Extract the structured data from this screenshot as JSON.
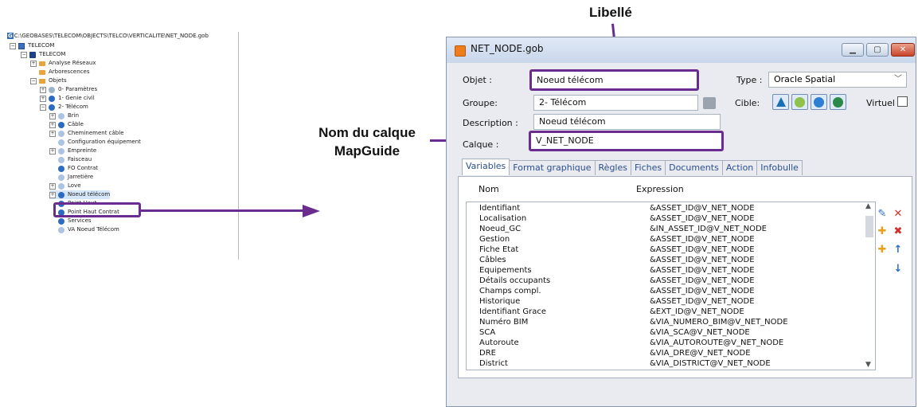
{
  "tree": {
    "path": "C:\\GEOBASES\\TELECOM\\OBJECTS\\TELCO\\VERTICALITE\\NET_NODE.gob",
    "path_badge": "G",
    "items": [
      {
        "label": "TELECOM",
        "icon": "grid-icon"
      },
      {
        "label": "TELECOM",
        "icon": "folder-icon"
      },
      {
        "label": "Analyse Réseaux",
        "icon": "folder-icon"
      },
      {
        "label": "Arborescences",
        "icon": "folder-icon"
      },
      {
        "label": "Objets",
        "icon": "folder-icon"
      },
      {
        "label": "0- Paramètres",
        "icon": "circle-icon"
      },
      {
        "label": "1- Genie civil",
        "icon": "circle-icon"
      },
      {
        "label": "2- Télécom",
        "icon": "circle-icon"
      },
      {
        "label": "Brin",
        "icon": "circle-icon"
      },
      {
        "label": "Câble",
        "icon": "circle-icon"
      },
      {
        "label": "Cheminement câble",
        "icon": "circle-icon"
      },
      {
        "label": "Configuration équipement",
        "icon": "circle-icon"
      },
      {
        "label": "Empreinte",
        "icon": "circle-icon"
      },
      {
        "label": "Faisceau",
        "icon": "circle-icon"
      },
      {
        "label": "FO Contrat",
        "icon": "circle-icon"
      },
      {
        "label": "Jarretière",
        "icon": "circle-icon"
      },
      {
        "label": "Love",
        "icon": "circle-icon"
      },
      {
        "label": "Noeud télécom",
        "icon": "circle-icon"
      },
      {
        "label": "Point Haut",
        "icon": "circle-icon"
      },
      {
        "label": "Point Haut Contrat",
        "icon": "circle-icon"
      },
      {
        "label": "Services",
        "icon": "circle-icon"
      },
      {
        "label": "VA Noeud Télécom",
        "icon": "circle-icon"
      }
    ]
  },
  "annotations": {
    "top": "Libellé",
    "side_line1": "Nom du calque",
    "side_line2": "MapGuide"
  },
  "colors": {
    "highlight": "#6a2c8f",
    "tab_text": "#2a4f8f",
    "title_icon": "#f07c1e"
  },
  "dialog": {
    "title": "NET_NODE.gob",
    "objet_label": "Objet :",
    "objet_value": "Noeud télécom",
    "type_label": "Type :",
    "type_value": "Oracle Spatial",
    "groupe_label": "Groupe:",
    "groupe_value": "2- Télécom",
    "cible_label": "Cible:",
    "virtuel_label": "Virtuel",
    "description_label": "Description :",
    "description_value": "Noeud télécom",
    "calque_label": "Calque :",
    "calque_value": "V_NET_NODE",
    "tabs": [
      "Variables",
      "Format graphique",
      "Règles",
      "Fiches",
      "Documents",
      "Action",
      "Infobulle"
    ],
    "col_nom": "Nom",
    "col_expression": "Expression",
    "variables": [
      {
        "nom": "Identifiant",
        "expr": "&ASSET_ID@V_NET_NODE"
      },
      {
        "nom": "Localisation",
        "expr": "&ASSET_ID@V_NET_NODE"
      },
      {
        "nom": "Noeud_GC",
        "expr": "&IN_ASSET_ID@V_NET_NODE"
      },
      {
        "nom": "Gestion",
        "expr": "&ASSET_ID@V_NET_NODE"
      },
      {
        "nom": "Fiche Etat",
        "expr": "&ASSET_ID@V_NET_NODE"
      },
      {
        "nom": "Câbles",
        "expr": "&ASSET_ID@V_NET_NODE"
      },
      {
        "nom": "Equipements",
        "expr": "&ASSET_ID@V_NET_NODE"
      },
      {
        "nom": "Détails occupants",
        "expr": "&ASSET_ID@V_NET_NODE"
      },
      {
        "nom": "Champs compl.",
        "expr": "&ASSET_ID@V_NET_NODE"
      },
      {
        "nom": "Historique",
        "expr": "&ASSET_ID@V_NET_NODE"
      },
      {
        "nom": "Identifiant Grace",
        "expr": "&EXT_ID@V_NET_NODE"
      },
      {
        "nom": "Numéro BIM",
        "expr": "&VIA_NUMERO_BIM@V_NET_NODE"
      },
      {
        "nom": "SCA",
        "expr": "&VIA_SCA@V_NET_NODE"
      },
      {
        "nom": "Autoroute",
        "expr": "&VIA_AUTOROUTE@V_NET_NODE"
      },
      {
        "nom": "DRE",
        "expr": "&VIA_DRE@V_NET_NODE"
      },
      {
        "nom": "District",
        "expr": "&VIA_DISTRICT@V_NET_NODE"
      }
    ]
  }
}
